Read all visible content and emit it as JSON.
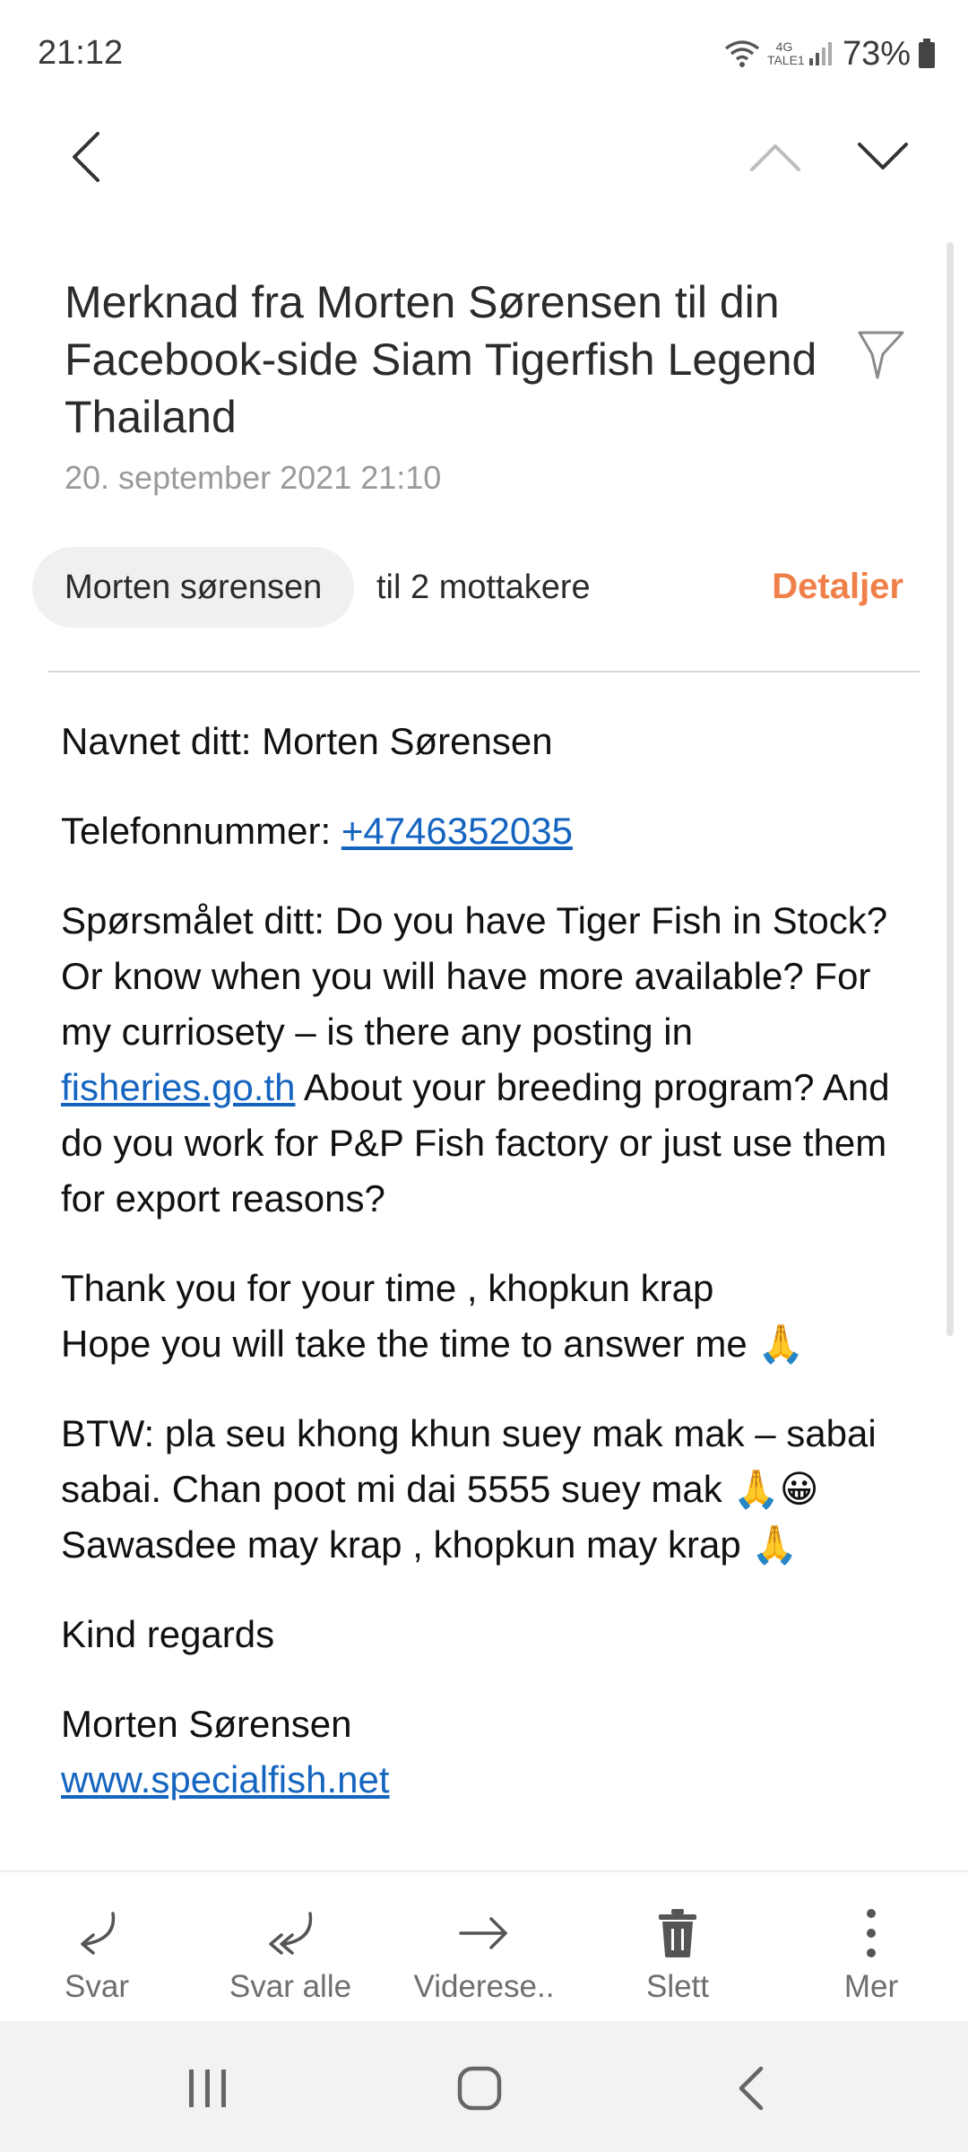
{
  "status_bar": {
    "time": "21:12",
    "network_top": "4G",
    "network_bottom": "TALE1",
    "battery": "73%"
  },
  "email": {
    "subject": "Merknad fra Morten Sørensen til din Facebook-side Siam Tigerfish Legend Thailand",
    "date": "20. september 2021  21:10",
    "sender": "Morten sørensen",
    "recipients": "til 2 mottakere",
    "details_label": "Detaljer",
    "body": {
      "name_line": "Navnet ditt: Morten Sørensen",
      "phone_label": "Telefonnummer: ",
      "phone": "+4746352035",
      "question_start": "Spørsmålet ditt: Do you have Tiger Fish in Stock? Or know when you will have more available? For my curriosety – is there any posting in ",
      "question_link": "fisheries.go.th",
      "question_end": " About your breeding program? And do you work for P&P Fish factory or just use them for export reasons?",
      "thanks_1": "Thank you for your time , khopkun krap",
      "thanks_2": "Hope you will take the time to answer me 🙏",
      "btw_1": "BTW: pla seu khong khun suey mak mak – sabai sabai. Chan poot mi dai 5555 suey mak 🙏😀",
      "btw_2": "Sawasdee may krap , khopkun may krap 🙏",
      "regards": "Kind regards",
      "signature_name": "Morten Sørensen",
      "signature_link": "www.specialfish.net"
    }
  },
  "actions": [
    {
      "label": "Svar",
      "icon": "reply-icon"
    },
    {
      "label": "Svar alle",
      "icon": "reply-all-icon"
    },
    {
      "label": "Viderese..",
      "icon": "forward-icon"
    },
    {
      "label": "Slett",
      "icon": "trash-icon"
    },
    {
      "label": "Mer",
      "icon": "more-vertical-icon"
    }
  ]
}
